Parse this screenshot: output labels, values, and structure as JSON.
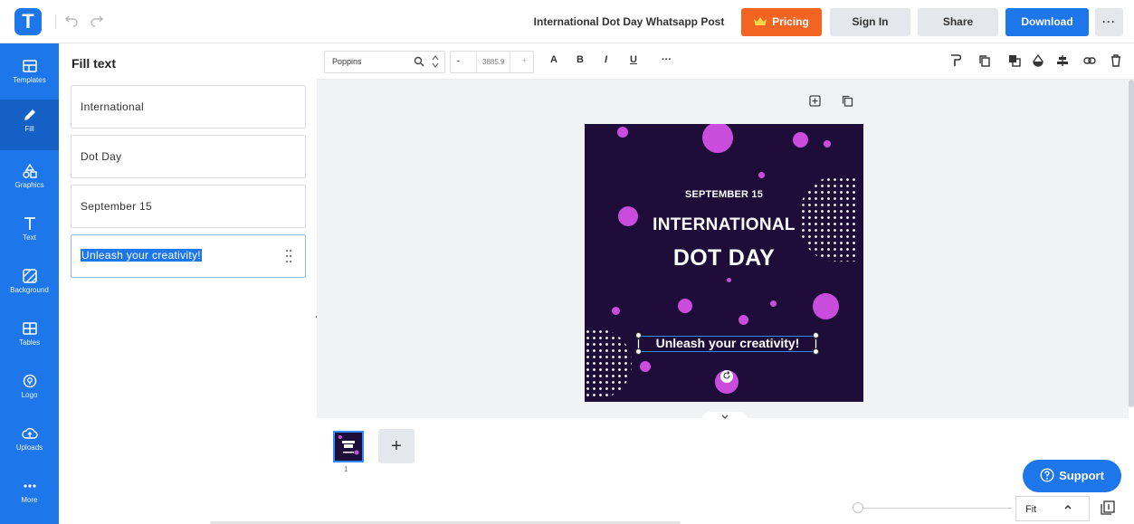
{
  "header": {
    "logo_letter": "T",
    "document_title": "International Dot Day Whatsapp Post",
    "pricing_label": "Pricing",
    "signin_label": "Sign In",
    "share_label": "Share",
    "download_label": "Download",
    "more_label": "···"
  },
  "sidebar": {
    "items": [
      {
        "label": "Templates",
        "icon": "templates-icon"
      },
      {
        "label": "Fill",
        "icon": "pencil-icon"
      },
      {
        "label": "Graphics",
        "icon": "shapes-icon"
      },
      {
        "label": "Text",
        "icon": "text-icon"
      },
      {
        "label": "Background",
        "icon": "background-icon"
      },
      {
        "label": "Tables",
        "icon": "table-icon"
      },
      {
        "label": "Logo",
        "icon": "logo-icon"
      },
      {
        "label": "Uploads",
        "icon": "upload-cloud-icon"
      },
      {
        "label": "More",
        "icon": "more-icon"
      }
    ],
    "active": "Fill"
  },
  "fill_panel": {
    "title": "Fill text",
    "fields": [
      {
        "value": "International"
      },
      {
        "value": "Dot Day"
      },
      {
        "value": "September 15"
      },
      {
        "value": "Unleash your creativity!"
      }
    ]
  },
  "toolbar": {
    "font_name": "Poppins",
    "font_size": "3885.9",
    "minus": "-",
    "plus": "+",
    "glyphs": [
      "A",
      "B",
      "I",
      "U",
      "···"
    ]
  },
  "design": {
    "date_text": "SEPTEMBER 15",
    "title_line1": "INTERNATIONAL",
    "title_line2": "DOT DAY",
    "tagline": "Unleash your creativity!",
    "background_color": "#1f0d39",
    "dot_color": "#c94cdc"
  },
  "pages": {
    "thumbnail_number": "1",
    "add_label": "+"
  },
  "footer": {
    "support_label": "Support",
    "zoom_value": "Fit"
  },
  "colors": {
    "brand_blue": "#1d76ea",
    "pricing_orange": "#f26422"
  }
}
